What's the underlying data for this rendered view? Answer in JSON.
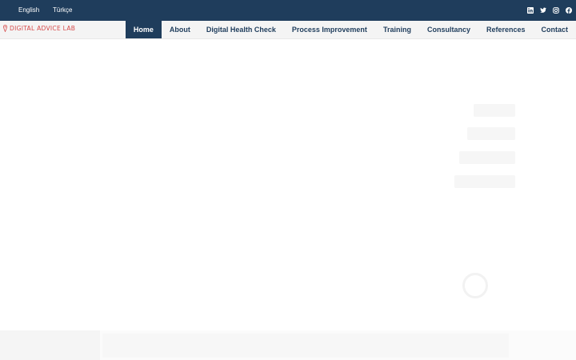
{
  "topbar": {
    "languages": [
      {
        "label": "English"
      },
      {
        "label": "Türkçe"
      }
    ],
    "socials": [
      "linkedin-icon",
      "twitter-icon",
      "instagram-icon",
      "facebook-icon"
    ]
  },
  "logo": {
    "text": "DIGITAL ADVICE LAB"
  },
  "nav": {
    "items": [
      {
        "label": "Home",
        "active": true
      },
      {
        "label": "About"
      },
      {
        "label": "Digital Health Check"
      },
      {
        "label": "Process Improvement"
      },
      {
        "label": "Training"
      },
      {
        "label": "Consultancy"
      },
      {
        "label": "References"
      },
      {
        "label": "Contact"
      }
    ]
  },
  "colors": {
    "primary": "#1f3d5c",
    "accent": "#d64a4a",
    "nav_bg": "#f4f4f4"
  }
}
